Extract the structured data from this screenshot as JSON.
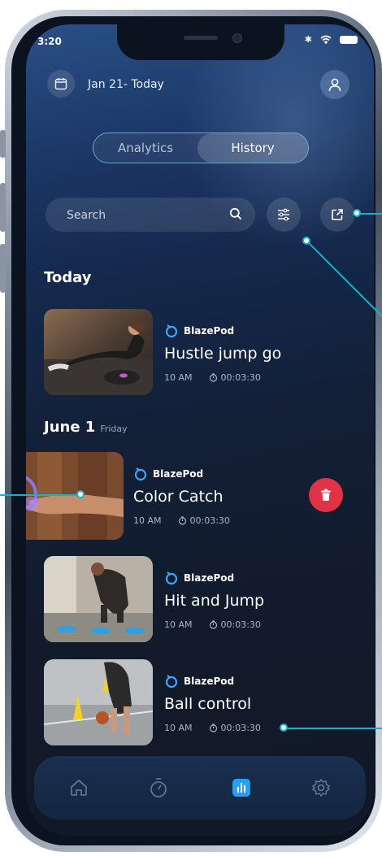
{
  "status": {
    "time": "3:20"
  },
  "header": {
    "date_range": "Jan 21- Today"
  },
  "tabs": {
    "left": "Analytics",
    "right": "History",
    "active": "History"
  },
  "search": {
    "placeholder": "Search"
  },
  "sections": [
    {
      "title": "Today",
      "subtitle": ""
    },
    {
      "title": "June 1",
      "subtitle": "Friday"
    }
  ],
  "workouts": [
    {
      "brand": "BlazePod",
      "title": "Hustle jump go",
      "time": "10 AM",
      "duration": "00:03:30"
    },
    {
      "brand": "BlazePod",
      "title": "Color Catch",
      "time": "10 AM",
      "duration": "00:03:30"
    },
    {
      "brand": "BlazePod",
      "title": "Hit and Jump",
      "time": "10 AM",
      "duration": "00:03:30"
    },
    {
      "brand": "BlazePod",
      "title": "Ball control",
      "time": "10 AM",
      "duration": "00:03:30"
    }
  ],
  "nav": [
    {
      "icon": "home-icon"
    },
    {
      "icon": "timer-icon"
    },
    {
      "icon": "stats-icon",
      "active": true
    },
    {
      "icon": "settings-icon"
    }
  ],
  "colors": {
    "accent": "#1ab0d0",
    "delete": "#e03346",
    "active_tab": "#2a9ef0"
  }
}
